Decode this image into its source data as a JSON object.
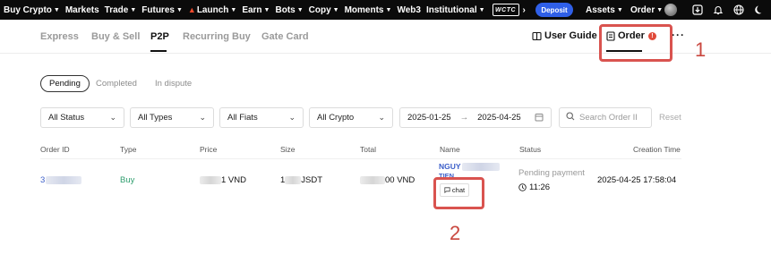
{
  "topnav": {
    "items": [
      {
        "label": "Buy Crypto",
        "caret": true
      },
      {
        "label": "Markets",
        "caret": false
      },
      {
        "label": "Trade",
        "caret": true
      },
      {
        "label": "Futures",
        "caret": true
      },
      {
        "label": "Launch",
        "caret": true
      },
      {
        "label": "Earn",
        "caret": true
      },
      {
        "label": "Bots",
        "caret": true
      },
      {
        "label": "Copy",
        "caret": true
      },
      {
        "label": "Moments",
        "caret": true
      },
      {
        "label": "Web3",
        "caret": false
      },
      {
        "label": "Institutional",
        "caret": true
      }
    ],
    "logo_text": "WCTC",
    "deposit_label": "Deposit",
    "assets_label": "Assets",
    "order_label": "Order"
  },
  "tabs": {
    "items": [
      "Express",
      "Buy & Sell",
      "P2P",
      "Recurring Buy",
      "Gate Card"
    ],
    "active": "P2P",
    "user_guide": "User Guide",
    "order": "Order",
    "order_badge": "!",
    "more": "···"
  },
  "annotations": {
    "one": "1",
    "two": "2"
  },
  "status_filters": [
    "Pending",
    "Completed",
    "In dispute"
  ],
  "filters": {
    "status": "All Status",
    "types": "All Types",
    "fiats": "All Fiats",
    "crypto": "All Crypto",
    "date_from": "2025-01-25",
    "date_to": "2025-04-25",
    "search_placeholder": "Search Order II",
    "reset": "Reset"
  },
  "table": {
    "headers": [
      "Order ID",
      "Type",
      "Price",
      "Size",
      "Total",
      "Name",
      "Status",
      "Creation Time"
    ],
    "row": {
      "order_id_prefix": "3",
      "type": "Buy",
      "price_suffix": "1 VND",
      "size_prefix": "1",
      "size_suffix": "JSDT",
      "total_suffix": "00 VND",
      "name_line1": "NGUY",
      "name_line2": "TIEN",
      "chat": "chat",
      "status": "Pending payment",
      "countdown": "11:26",
      "creation_time": "2025-04-25 17:58:04"
    }
  },
  "colors": {
    "accent_blue": "#2f5fe8",
    "annotation_red": "#d9534f",
    "buy_green": "#2f9e6e"
  }
}
